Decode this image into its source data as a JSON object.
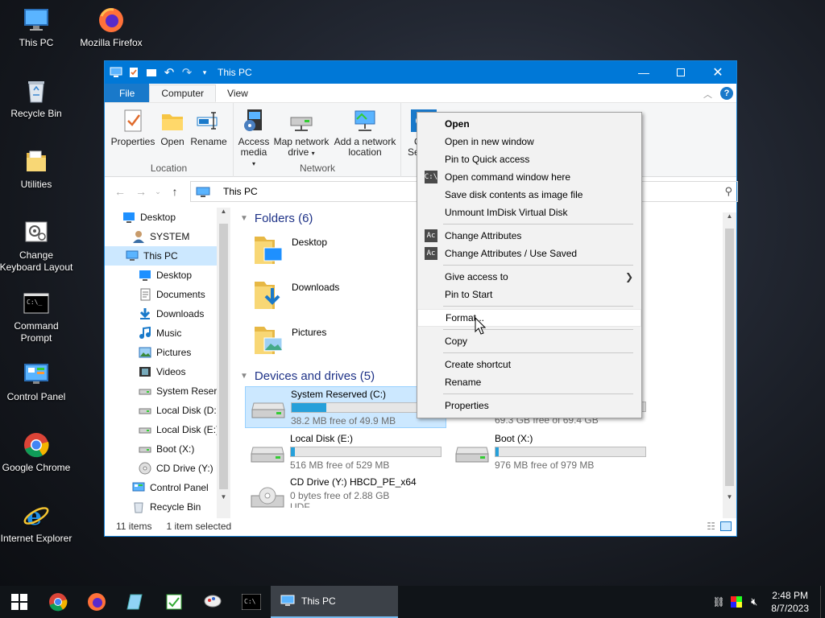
{
  "desktop": {
    "icons": [
      {
        "label": "This PC",
        "icon": "monitor-icon"
      },
      {
        "label": "Mozilla Firefox",
        "icon": "firefox-icon"
      },
      {
        "label": "Recycle Bin",
        "icon": "recycle-bin-icon"
      },
      {
        "label": "Utilities",
        "icon": "folder-icon"
      },
      {
        "label": "Change Keyboard Layout",
        "icon": "keyboard-settings-icon"
      },
      {
        "label": "Command Prompt",
        "icon": "cmd-icon"
      },
      {
        "label": "Control Panel",
        "icon": "control-panel-icon"
      },
      {
        "label": "Google Chrome",
        "icon": "chrome-icon"
      },
      {
        "label": "Internet Explorer",
        "icon": "ie-icon"
      }
    ]
  },
  "window": {
    "title": "This PC",
    "ribbon_tabs": [
      "File",
      "Computer",
      "View"
    ],
    "ribbon": {
      "location_group": "Location",
      "network_group": "Network",
      "properties": "Properties",
      "open": "Open",
      "rename": "Rename",
      "access_media_l1": "Access",
      "access_media_l2": "media",
      "map_drive_l1": "Map network",
      "map_drive_l2": "drive",
      "add_location_l1": "Add a network",
      "add_location_l2": "location",
      "partial_l1": "O",
      "partial_l2": "Se"
    },
    "address": "This PC",
    "sidebar": [
      {
        "label": "Desktop",
        "indent": 0,
        "icon": "desktop-icon"
      },
      {
        "label": "SYSTEM",
        "indent": 1,
        "icon": "user-icon"
      },
      {
        "label": "This PC",
        "indent": 1,
        "icon": "monitor-icon",
        "selected": true
      },
      {
        "label": "Desktop",
        "indent": 2,
        "icon": "desktop-icon"
      },
      {
        "label": "Documents",
        "indent": 2,
        "icon": "documents-icon"
      },
      {
        "label": "Downloads",
        "indent": 2,
        "icon": "download-icon"
      },
      {
        "label": "Music",
        "indent": 2,
        "icon": "music-icon"
      },
      {
        "label": "Pictures",
        "indent": 2,
        "icon": "pictures-icon"
      },
      {
        "label": "Videos",
        "indent": 2,
        "icon": "videos-icon"
      },
      {
        "label": "System Reserve",
        "indent": 2,
        "icon": "drive-icon"
      },
      {
        "label": "Local Disk (D:)",
        "indent": 2,
        "icon": "drive-icon"
      },
      {
        "label": "Local Disk (E:)",
        "indent": 2,
        "icon": "drive-icon"
      },
      {
        "label": "Boot (X:)",
        "indent": 2,
        "icon": "drive-icon"
      },
      {
        "label": "CD Drive (Y:) H",
        "indent": 2,
        "icon": "cd-icon"
      },
      {
        "label": "Control Panel",
        "indent": 1,
        "icon": "control-panel-icon"
      },
      {
        "label": "Recycle Bin",
        "indent": 1,
        "icon": "recycle-bin-icon"
      }
    ],
    "folders_header": "Folders (6)",
    "folders": [
      {
        "name": "Desktop",
        "icon": "desktop-folder-icon"
      },
      {
        "name": "Downloads",
        "icon": "downloads-folder-icon"
      },
      {
        "name": "Pictures",
        "icon": "pictures-folder-icon"
      }
    ],
    "drives_header": "Devices and drives (5)",
    "drives": [
      {
        "name": "System Reserved (C:)",
        "free": "38.2 MB free of 49.9 MB",
        "used_fraction": 0.23,
        "selected": true,
        "icon": "drive-icon"
      },
      {
        "name": "",
        "free": "69.3 GB free of 69.4 GB",
        "used_fraction": 0.01,
        "selected": false,
        "icon": "drive-icon"
      },
      {
        "name": "Local Disk (E:)",
        "free": "516 MB free of 529 MB",
        "used_fraction": 0.025,
        "selected": false,
        "icon": "drive-icon"
      },
      {
        "name": "Boot (X:)",
        "free": "976 MB free of 979 MB",
        "used_fraction": 0.003,
        "selected": false,
        "icon": "drive-icon"
      },
      {
        "name": "CD Drive (Y:) HBCD_PE_x64",
        "free": "0 bytes free of 2.88 GB",
        "used_fraction": 1.0,
        "selected": false,
        "icon": "cd-drive-icon",
        "extra": "UDF"
      }
    ],
    "status": {
      "items": "11 items",
      "selected": "1 item selected"
    }
  },
  "context_menu": [
    {
      "label": "Open",
      "bold": true
    },
    {
      "label": "Open in new window"
    },
    {
      "label": "Pin to Quick access"
    },
    {
      "label": "Open command window here",
      "icon": "cmd-icon",
      "icon_text": "C:\\"
    },
    {
      "label": "Save disk contents as image file"
    },
    {
      "label": "Unmount ImDisk Virtual Disk"
    },
    {
      "sep": true
    },
    {
      "label": "Change Attributes",
      "icon": "attrib-icon",
      "icon_text": "Ac"
    },
    {
      "label": "Change Attributes / Use Saved",
      "icon": "attrib-icon",
      "icon_text": "Ac"
    },
    {
      "sep": true
    },
    {
      "label": "Give access to",
      "submenu": true
    },
    {
      "label": "Pin to Start"
    },
    {
      "sep": true
    },
    {
      "label": "Format...",
      "hover": true
    },
    {
      "sep": true
    },
    {
      "label": "Copy"
    },
    {
      "sep": true
    },
    {
      "label": "Create shortcut"
    },
    {
      "label": "Rename"
    },
    {
      "sep": true
    },
    {
      "label": "Properties"
    }
  ],
  "taskbar": {
    "pinned": [
      "start-icon",
      "chrome-icon",
      "firefox-icon",
      "notepad-icon",
      "regedit-icon",
      "snipping-icon",
      "cmd-icon"
    ],
    "active_app": "This PC",
    "time": "2:48 PM",
    "date": "8/7/2023"
  },
  "colors": {
    "accent": "#0078d7",
    "selection": "#cce8ff",
    "drive_bar": "#26a0da"
  }
}
